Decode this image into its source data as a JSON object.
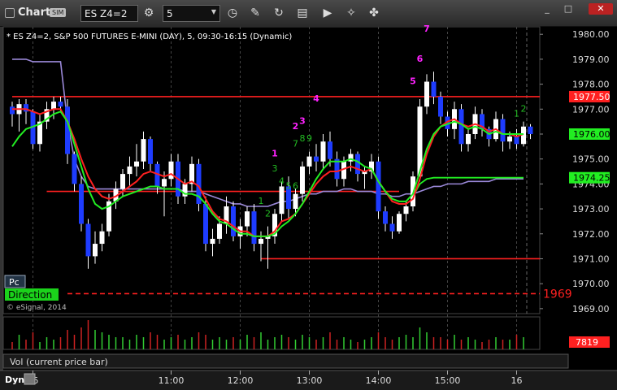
{
  "window": {
    "app_label": "Chart",
    "sim_badge": "SIM",
    "symbol": "ES Z4=2",
    "interval": "5",
    "tools": [
      "sync-icon",
      "draw-icon",
      "study-icon",
      "news-icon",
      "play-icon",
      "pencil-icon",
      "chain-icon"
    ],
    "tool_glyphs": [
      "⚙",
      "◷",
      "✎",
      "↻",
      "▤",
      "▶",
      "✤"
    ]
  },
  "header": {
    "title": "* ES Z4=2, S&P 500 FUTURES E-MINI (DAY), 5, 09:30-16:15 (Dynamic)"
  },
  "copyright": "© eSignal, 2014",
  "buttons": {
    "pc": "Pc",
    "direction": "Direction",
    "dyn": "Dyn"
  },
  "vol_label": "Vol (current price bar)",
  "colors": {
    "up": "#ffffff",
    "down": "#1e3cff",
    "red": "#ff2020",
    "green_line": "#22ee22",
    "purple_line": "#9a88d8",
    "magenta": "#ff22ff",
    "green_label": "#22bb22"
  },
  "chart_data": {
    "type": "candlestick",
    "title": "* ES Z4=2, S&P 500 FUTURES E-MINI (DAY), 5, 09:30-16:15 (Dynamic)",
    "ylim": [
      1968.8,
      1980.3
    ],
    "y_ticks": [
      "1980.00",
      "1979.00",
      "1978.00",
      "1977.00",
      "1976.00",
      "1975.00",
      "1974.00",
      "1973.00",
      "1972.00",
      "1971.00",
      "1970.00",
      "1969.00"
    ],
    "x_ticks": [
      "15",
      "11:00",
      "12:00",
      "13:00",
      "14:00",
      "15:00",
      "16"
    ],
    "x_tick_bar_index": [
      3,
      23,
      33,
      43,
      53,
      63,
      73
    ],
    "price_labels": [
      {
        "value": 1977.5,
        "text": "1977.50",
        "style": "red"
      },
      {
        "value": 1976.0,
        "text": "1976.00",
        "style": "green"
      },
      {
        "value": 1974.25,
        "text": "1974.25",
        "style": "green"
      }
    ],
    "side_label": "1969",
    "horizontal_levels": [
      {
        "value": 1977.5,
        "from_bar": 0,
        "to_bar": 75,
        "color": "red"
      },
      {
        "value": 1973.7,
        "from_bar": 5,
        "to_bar": 56,
        "color": "red"
      },
      {
        "value": 1971.0,
        "from_bar": 36,
        "to_bar": 75,
        "color": "red"
      },
      {
        "value": 1969.6,
        "from_bar": 8,
        "to_bar": 75,
        "color": "red",
        "dashed": true
      }
    ],
    "candles": [
      [
        1977.1,
        1977.3,
        1976.3,
        1976.8
      ],
      [
        1976.8,
        1977.4,
        1976.1,
        1977.2
      ],
      [
        1977.2,
        1977.4,
        1976.4,
        1976.9
      ],
      [
        1976.9,
        1977.0,
        1975.4,
        1975.6
      ],
      [
        1975.6,
        1976.8,
        1975.3,
        1976.5
      ],
      [
        1976.5,
        1977.3,
        1976.2,
        1977.0
      ],
      [
        1977.0,
        1977.5,
        1976.6,
        1977.3
      ],
      [
        1977.3,
        1977.5,
        1976.9,
        1977.1
      ],
      [
        1977.1,
        1977.4,
        1974.8,
        1975.2
      ],
      [
        1975.2,
        1975.3,
        1973.7,
        1974.0
      ],
      [
        1974.0,
        1974.3,
        1972.1,
        1972.4
      ],
      [
        1972.4,
        1972.6,
        1970.6,
        1971.1
      ],
      [
        1971.1,
        1972.1,
        1970.8,
        1971.6
      ],
      [
        1971.6,
        1972.4,
        1971.3,
        1972.1
      ],
      [
        1972.1,
        1973.6,
        1971.9,
        1973.3
      ],
      [
        1973.3,
        1974.1,
        1973.0,
        1973.8
      ],
      [
        1973.8,
        1974.6,
        1973.5,
        1974.4
      ],
      [
        1974.4,
        1975.1,
        1973.9,
        1974.7
      ],
      [
        1974.7,
        1975.6,
        1974.3,
        1974.9
      ],
      [
        1974.9,
        1976.1,
        1974.6,
        1975.8
      ],
      [
        1975.8,
        1975.9,
        1974.5,
        1974.8
      ],
      [
        1974.8,
        1974.9,
        1973.6,
        1973.9
      ],
      [
        1973.9,
        1974.5,
        1972.7,
        1974.2
      ],
      [
        1974.2,
        1975.2,
        1973.9,
        1974.9
      ],
      [
        1974.9,
        1975.2,
        1973.2,
        1973.5
      ],
      [
        1973.5,
        1974.2,
        1973.2,
        1974.0
      ],
      [
        1974.0,
        1975.1,
        1973.7,
        1974.8
      ],
      [
        1974.8,
        1975.0,
        1972.9,
        1973.2
      ],
      [
        1973.2,
        1973.5,
        1971.3,
        1971.6
      ],
      [
        1971.6,
        1972.2,
        1971.1,
        1971.8
      ],
      [
        1971.8,
        1972.7,
        1971.6,
        1972.4
      ],
      [
        1972.4,
        1973.5,
        1972.0,
        1973.1
      ],
      [
        1973.1,
        1973.3,
        1971.7,
        1971.9
      ],
      [
        1971.9,
        1972.6,
        1971.4,
        1972.3
      ],
      [
        1972.3,
        1973.1,
        1971.9,
        1972.9
      ],
      [
        1972.9,
        1973.2,
        1971.3,
        1971.6
      ],
      [
        1971.6,
        1972.1,
        1970.9,
        1971.8
      ],
      [
        1971.8,
        1972.3,
        1970.6,
        1971.9
      ],
      [
        1971.9,
        1973.0,
        1971.6,
        1972.8
      ],
      [
        1972.8,
        1974.1,
        1972.5,
        1973.9
      ],
      [
        1973.9,
        1974.3,
        1972.6,
        1973.0
      ],
      [
        1973.0,
        1973.8,
        1972.7,
        1973.6
      ],
      [
        1973.6,
        1974.9,
        1973.3,
        1974.7
      ],
      [
        1974.7,
        1975.3,
        1974.4,
        1975.1
      ],
      [
        1975.1,
        1975.6,
        1974.5,
        1974.9
      ],
      [
        1974.9,
        1976.0,
        1974.6,
        1975.7
      ],
      [
        1975.7,
        1976.1,
        1974.7,
        1975.0
      ],
      [
        1975.0,
        1975.3,
        1973.9,
        1974.2
      ],
      [
        1974.2,
        1975.1,
        1973.9,
        1974.9
      ],
      [
        1974.9,
        1975.4,
        1974.5,
        1975.2
      ],
      [
        1975.2,
        1975.3,
        1974.1,
        1974.4
      ],
      [
        1974.4,
        1974.7,
        1973.8,
        1974.5
      ],
      [
        1974.5,
        1975.2,
        1974.2,
        1974.9
      ],
      [
        1974.9,
        1975.1,
        1972.6,
        1972.9
      ],
      [
        1972.9,
        1973.1,
        1972.1,
        1972.4
      ],
      [
        1972.4,
        1972.7,
        1971.8,
        1972.1
      ],
      [
        1972.1,
        1972.9,
        1972.0,
        1972.8
      ],
      [
        1972.8,
        1973.3,
        1972.5,
        1973.1
      ],
      [
        1973.1,
        1974.5,
        1972.9,
        1974.3
      ],
      [
        1974.3,
        1977.4,
        1974.1,
        1977.1
      ],
      [
        1977.1,
        1978.4,
        1976.8,
        1978.1
      ],
      [
        1978.1,
        1978.5,
        1977.2,
        1977.5
      ],
      [
        1977.5,
        1977.7,
        1976.4,
        1976.7
      ],
      [
        1976.7,
        1976.9,
        1975.9,
        1976.2
      ],
      [
        1976.2,
        1977.3,
        1975.8,
        1977.0
      ],
      [
        1977.0,
        1977.2,
        1975.3,
        1975.6
      ],
      [
        1975.6,
        1976.2,
        1975.3,
        1976.0
      ],
      [
        1976.0,
        1977.1,
        1975.8,
        1976.8
      ],
      [
        1976.8,
        1977.0,
        1975.9,
        1976.2
      ],
      [
        1976.2,
        1976.3,
        1975.5,
        1975.8
      ],
      [
        1975.8,
        1976.9,
        1975.7,
        1976.6
      ],
      [
        1976.6,
        1976.8,
        1975.3,
        1975.7
      ],
      [
        1975.7,
        1976.1,
        1975.4,
        1975.9
      ],
      [
        1975.9,
        1976.2,
        1975.4,
        1975.6
      ],
      [
        1975.6,
        1976.5,
        1975.5,
        1976.3
      ],
      [
        1976.3,
        1976.4,
        1975.8,
        1976.0
      ]
    ],
    "volumes": [
      3,
      6,
      4,
      7,
      3,
      5,
      4,
      5,
      8,
      6,
      9,
      12,
      8,
      7,
      6,
      5,
      5,
      4,
      6,
      5,
      7,
      6,
      4,
      5,
      6,
      4,
      5,
      7,
      6,
      4,
      5,
      4,
      5,
      4,
      6,
      5,
      7,
      4,
      5,
      6,
      5,
      4,
      6,
      5,
      4,
      5,
      7,
      4,
      5,
      4,
      3,
      4,
      5,
      7,
      5,
      4,
      5,
      6,
      5,
      9,
      7,
      5,
      5,
      4,
      6,
      4,
      5,
      4,
      3,
      4,
      5,
      4,
      4,
      6,
      5
    ],
    "overlays": {
      "red_ma": [
        1977.0,
        1977.0,
        1977.0,
        1976.9,
        1976.8,
        1976.9,
        1977.0,
        1977.0,
        1976.5,
        1975.8,
        1975.0,
        1974.3,
        1973.8,
        1973.5,
        1973.4,
        1973.5,
        1973.7,
        1973.9,
        1974.1,
        1974.4,
        1974.5,
        1974.4,
        1974.3,
        1974.4,
        1974.2,
        1974.0,
        1974.1,
        1973.9,
        1973.4,
        1972.9,
        1972.6,
        1972.5,
        1972.3,
        1972.1,
        1972.1,
        1971.9,
        1971.9,
        1971.9,
        1972.1,
        1972.5,
        1972.6,
        1972.8,
        1973.2,
        1973.6,
        1974.0,
        1974.3,
        1974.5,
        1974.5,
        1974.6,
        1974.7,
        1974.6,
        1974.5,
        1974.6,
        1974.1,
        1973.7,
        1973.3,
        1973.2,
        1973.2,
        1973.4,
        1974.2,
        1975.2,
        1975.9,
        1976.3,
        1976.5,
        1976.6,
        1976.4,
        1976.3,
        1976.4,
        1976.3,
        1976.1,
        1976.2,
        1976.0,
        1976.0,
        1975.9,
        1976.0
      ],
      "green_ma": [
        1975.5,
        1975.9,
        1976.2,
        1976.3,
        1976.4,
        1976.6,
        1976.8,
        1976.9,
        1976.5,
        1975.6,
        1974.7,
        1973.8,
        1973.2,
        1973.0,
        1973.1,
        1973.3,
        1973.5,
        1973.6,
        1973.7,
        1973.8,
        1973.9,
        1973.9,
        1973.8,
        1973.8,
        1973.8,
        1973.6,
        1973.6,
        1973.5,
        1973.2,
        1972.8,
        1972.5,
        1972.4,
        1972.2,
        1972.0,
        1972.0,
        1971.9,
        1971.9,
        1971.9,
        1972.0,
        1972.3,
        1972.5,
        1972.8,
        1973.2,
        1973.7,
        1974.2,
        1974.6,
        1974.9,
        1974.9,
        1974.9,
        1975.0,
        1974.9,
        1974.7,
        1974.6,
        1974.1,
        1973.7,
        1973.4,
        1973.3,
        1973.3,
        1973.6,
        1974.5,
        1975.4,
        1976.0,
        1976.3,
        1976.4,
        1976.5,
        1976.4,
        1976.2,
        1976.3,
        1976.2,
        1976.0,
        1976.1,
        1976.0,
        1976.0,
        1976.0,
        1976.0
      ],
      "purple_ma": [
        1979.0,
        1979.0,
        1979.0,
        1978.9,
        1978.9,
        1978.9,
        1978.9,
        1978.9,
        1976.5,
        1975.0,
        1974.3,
        1973.9,
        1973.8,
        1973.8,
        1973.8,
        1973.8,
        1973.8,
        1973.8,
        1973.8,
        1973.8,
        1973.8,
        1973.8,
        1973.8,
        1973.8,
        1973.8,
        1973.7,
        1973.7,
        1973.7,
        1973.6,
        1973.5,
        1973.4,
        1973.3,
        1973.2,
        1973.2,
        1973.1,
        1973.1,
        1973.1,
        1973.1,
        1973.2,
        1973.3,
        1973.3,
        1973.4,
        1973.5,
        1973.6,
        1973.6,
        1973.7,
        1973.7,
        1973.7,
        1973.8,
        1973.8,
        1973.7,
        1973.7,
        1973.7,
        1973.6,
        1973.6,
        1973.5,
        1973.5,
        1973.6,
        1973.6,
        1973.7,
        1973.8,
        1973.9,
        1973.9,
        1974.0,
        1974.0,
        1974.0,
        1974.1,
        1974.1,
        1974.1,
        1974.1,
        1974.2,
        1974.2,
        1974.2,
        1974.2,
        1974.2
      ],
      "green_step": [
        null,
        null,
        null,
        null,
        null,
        null,
        null,
        null,
        null,
        null,
        null,
        null,
        null,
        null,
        null,
        null,
        null,
        null,
        null,
        null,
        null,
        null,
        null,
        null,
        null,
        null,
        null,
        null,
        null,
        null,
        null,
        null,
        null,
        null,
        null,
        null,
        null,
        null,
        null,
        null,
        null,
        null,
        null,
        null,
        null,
        null,
        null,
        null,
        null,
        null,
        null,
        null,
        null,
        null,
        null,
        null,
        null,
        null,
        1973.5,
        1974.0,
        1974.2,
        1974.25,
        1974.25,
        1974.25,
        1974.25,
        1974.25,
        1974.25,
        1974.25,
        1974.25,
        1974.25,
        1974.25,
        1974.25,
        1974.25,
        1974.25,
        1974.25
      ]
    },
    "annotations": [
      {
        "text": "7",
        "bar": 60,
        "value": 1980.1,
        "color": "magenta"
      },
      {
        "text": "6",
        "bar": 59,
        "value": 1978.9,
        "color": "magenta"
      },
      {
        "text": "5",
        "bar": 58,
        "value": 1978.0,
        "color": "magenta"
      },
      {
        "text": "4",
        "bar": 44,
        "value": 1977.3,
        "color": "magenta"
      },
      {
        "text": "2",
        "bar": 41,
        "value": 1976.2,
        "color": "magenta"
      },
      {
        "text": "3",
        "bar": 42,
        "value": 1976.4,
        "color": "magenta"
      },
      {
        "text": "1",
        "bar": 38,
        "value": 1975.1,
        "color": "magenta"
      },
      {
        "text": "7",
        "bar": 41,
        "value": 1975.5,
        "color": "green"
      },
      {
        "text": "8",
        "bar": 42,
        "value": 1975.7,
        "color": "green"
      },
      {
        "text": "9",
        "bar": 43,
        "value": 1975.7,
        "color": "green"
      },
      {
        "text": "3",
        "bar": 38,
        "value": 1974.5,
        "color": "green"
      },
      {
        "text": "4",
        "bar": 39,
        "value": 1974.0,
        "color": "green"
      },
      {
        "text": "5",
        "bar": 40,
        "value": 1973.8,
        "color": "green"
      },
      {
        "text": "6",
        "bar": 41,
        "value": 1973.8,
        "color": "green"
      },
      {
        "text": "1",
        "bar": 36,
        "value": 1973.2,
        "color": "green"
      },
      {
        "text": "2",
        "bar": 37,
        "value": 1972.7,
        "color": "green"
      },
      {
        "text": "1",
        "bar": 73,
        "value": 1976.7,
        "color": "green"
      },
      {
        "text": "2",
        "bar": 74,
        "value": 1976.9,
        "color": "green"
      }
    ],
    "volume_label": "7819"
  }
}
